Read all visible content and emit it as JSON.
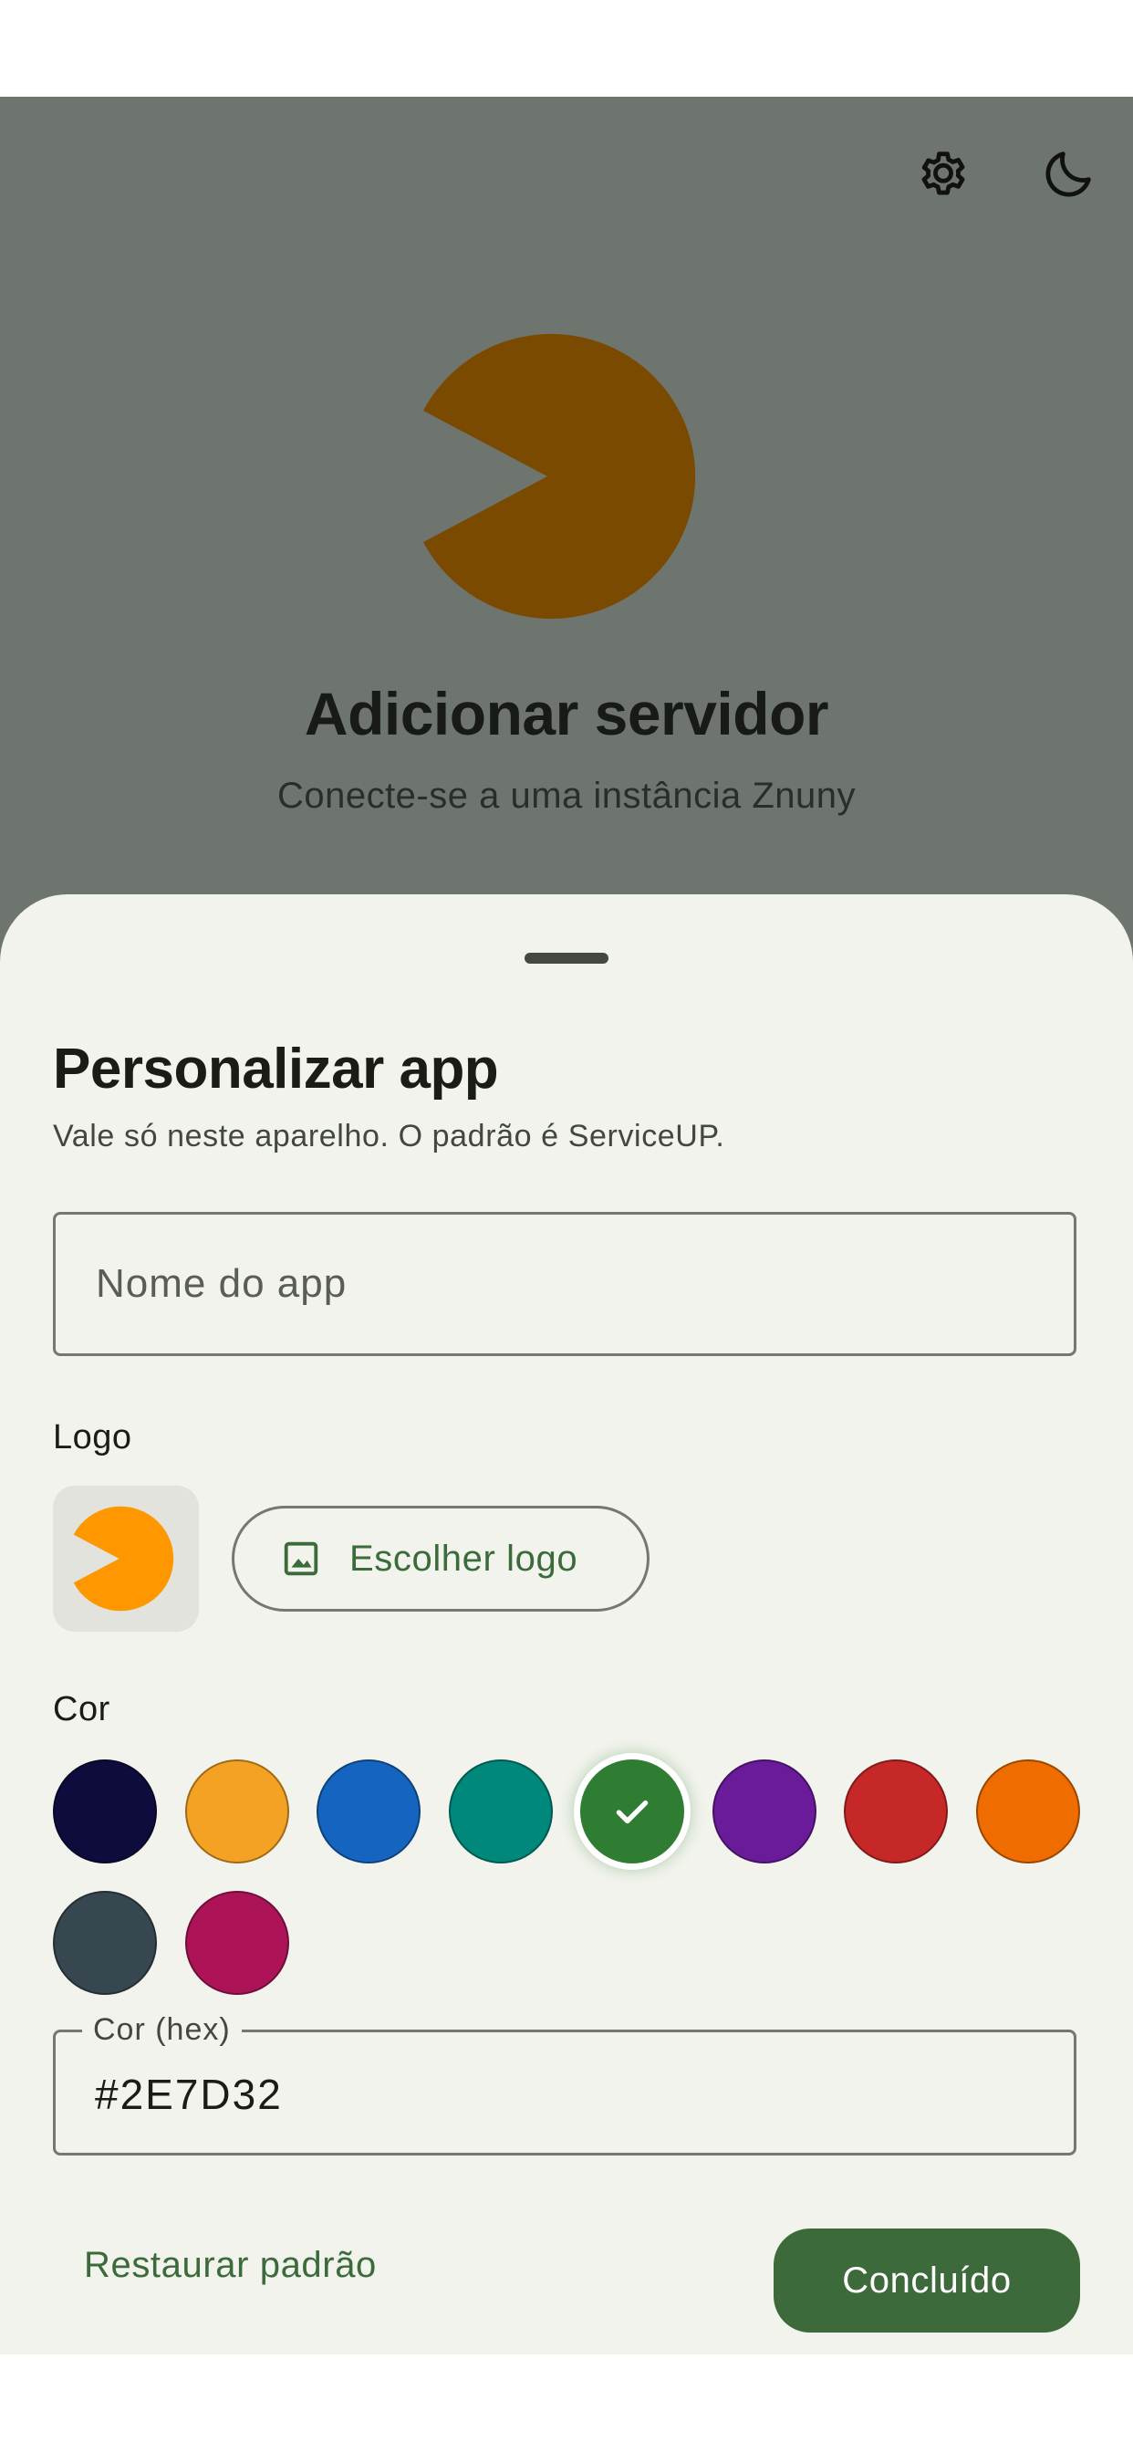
{
  "background_screen": {
    "title": "Adicionar servidor",
    "subtitle": "Conecte-se a uma instância Znuny",
    "actions": [
      {
        "icon": "gear-icon"
      },
      {
        "icon": "moon-icon"
      }
    ],
    "logo_color": "#7a4a00"
  },
  "sheet": {
    "title": "Personalizar app",
    "subtitle": "Vale só neste aparelho. O padrão é ServiceUP.",
    "app_name": {
      "value": "",
      "placeholder": "Nome do app"
    },
    "logo": {
      "label": "Logo",
      "preview_color": "#ff9800",
      "choose_button": {
        "label": "Escolher logo",
        "icon": "image-icon"
      }
    },
    "color": {
      "label": "Cor",
      "swatches": [
        {
          "hex": "#0e0c3d",
          "selected": false
        },
        {
          "hex": "#f4a223",
          "selected": false
        },
        {
          "hex": "#1565c0",
          "selected": false
        },
        {
          "hex": "#00897b",
          "selected": false
        },
        {
          "hex": "#2e7d32",
          "selected": true
        },
        {
          "hex": "#6a1b9a",
          "selected": false
        },
        {
          "hex": "#c62828",
          "selected": false
        },
        {
          "hex": "#ef6c00",
          "selected": false
        },
        {
          "hex": "#37474f",
          "selected": false
        },
        {
          "hex": "#ad1457",
          "selected": false
        }
      ],
      "hex_field": {
        "label": "Cor (hex)",
        "value": "#2E7D32"
      }
    },
    "reset_label": "Restaurar padrão",
    "done_label": "Concluído",
    "accent": "#3c6a3a"
  }
}
